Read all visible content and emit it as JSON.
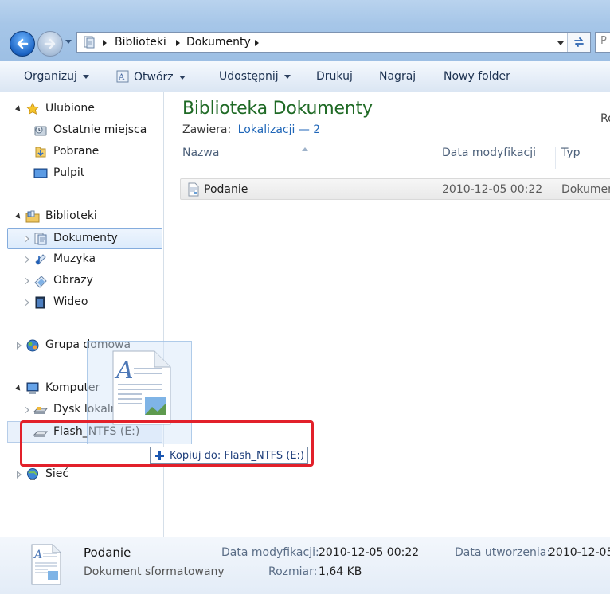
{
  "address": {
    "crumbs": [
      "Biblioteki",
      "Dokumenty"
    ],
    "search_placeholder": "P"
  },
  "toolbar": {
    "organize": "Organizuj",
    "open": "Otwórz",
    "share": "Udostępnij",
    "print": "Drukuj",
    "burn": "Nagraj",
    "new_folder": "Nowy folder"
  },
  "nav": {
    "favorites": "Ulubione",
    "recent": "Ostatnie miejsca",
    "downloads": "Pobrane",
    "desktop": "Pulpit",
    "libraries": "Biblioteki",
    "documents": "Dokumenty",
    "music": "Muzyka",
    "pictures": "Obrazy",
    "videos": "Wideo",
    "homegroup": "Grupa domowa",
    "computer": "Komputer",
    "local_disk": "Dysk lokalny (C:)",
    "flash": "Flash_NTFS (E:)",
    "network": "Sieć"
  },
  "main": {
    "title": "Biblioteka Dokumenty",
    "includes_label": "Zawiera:",
    "includes_link": "Lokalizacji — 2",
    "arrange_by": "Ro",
    "columns": {
      "name": "Nazwa",
      "date": "Data modyfikacji",
      "type": "Typ"
    },
    "files": [
      {
        "name": "Podanie",
        "date": "2010-12-05 00:22",
        "type": "Dokumen"
      }
    ]
  },
  "drag": {
    "tooltip": "Kopiuj do: Flash_NTFS (E:)"
  },
  "details": {
    "name": "Podanie",
    "type": "Dokument sformatowany",
    "modified_label": "Data modyfikacji:",
    "modified_value": "2010-12-05 00:22",
    "size_label": "Rozmiar:",
    "size_value": "1,64 KB",
    "created_label": "Data utworzenia:",
    "created_value": "2010-12-05"
  },
  "colors": {
    "title_green": "#1f6a25",
    "link_blue": "#1f66b8",
    "highlight_red": "#e2202a"
  }
}
